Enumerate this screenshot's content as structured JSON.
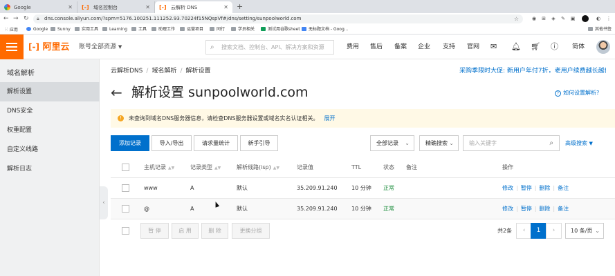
{
  "browser": {
    "tabs": [
      {
        "title": "Google",
        "favicon": "google-icon"
      },
      {
        "title": "域名控制台",
        "favicon": "aliyun-icon"
      },
      {
        "title": "云解析 DNS",
        "favicon": "aliyun-icon",
        "active": true
      }
    ],
    "new_tab": "+",
    "url": "dns.console.aliyun.com/?spm=5176.100251.111252.93.70224f15NQspVf#/dns/setting/sunpoolworld.com",
    "bookmarks": [
      "应用",
      "Google",
      "Sunny",
      "实用工具",
      "Learning",
      "工具",
      "助理工作",
      "运营项目",
      "同行",
      "学员相关",
      "测试用谷歌sheet",
      "无标题文档 - Goog...",
      "其他书签"
    ]
  },
  "topnav": {
    "logo": "阿里云",
    "account": "账号全部资源",
    "search_placeholder": "搜索文档、控制台、API、解决方案和资源",
    "items": [
      "费用",
      "售后",
      "备案",
      "企业",
      "支持",
      "官网"
    ],
    "lang": "简体"
  },
  "sidebar": {
    "title": "域名解析",
    "items": [
      "解析设置",
      "DNS安全",
      "权重配置",
      "自定义线路",
      "解析日志"
    ]
  },
  "breadcrumb": [
    "云解析DNS",
    "域名解析",
    "解析设置"
  ],
  "promo": "采购季限时大促: 新用户年付7折，老用户续费越长越优惠",
  "page_title": "解析设置 sunpoolworld.com",
  "help_link": "如何设置解析?",
  "alert": {
    "text": "未查询到域名DNS服务器信息，请检查DNS服务器设置或域名实名认证相关。",
    "link": "展开"
  },
  "toolbar": {
    "add": "添加记录",
    "import_export": "导入/导出",
    "stats": "请求量统计",
    "guide": "新手引导",
    "filter": "全部记录",
    "search_mode": "精确搜索",
    "keyword_placeholder": "输入关键字",
    "advanced": "高级搜索"
  },
  "table": {
    "headers": [
      "主机记录",
      "记录类型",
      "解析线路(isp)",
      "记录值",
      "TTL",
      "状态",
      "备注",
      "操作"
    ],
    "rows": [
      {
        "host": "www",
        "type": "A",
        "line": "默认",
        "value": "35.209.91.240",
        "ttl": "10 分钟",
        "status": "正常"
      },
      {
        "host": "@",
        "type": "A",
        "line": "默认",
        "value": "35.209.91.240",
        "ttl": "10 分钟",
        "status": "正常"
      }
    ],
    "actions": [
      "修改",
      "暂停",
      "删除",
      "备注"
    ]
  },
  "footer": {
    "batch": [
      "暂 停",
      "启 用",
      "删 除",
      "更换分组"
    ],
    "total": "共2条",
    "page": "1",
    "page_size": "10 条/页"
  }
}
